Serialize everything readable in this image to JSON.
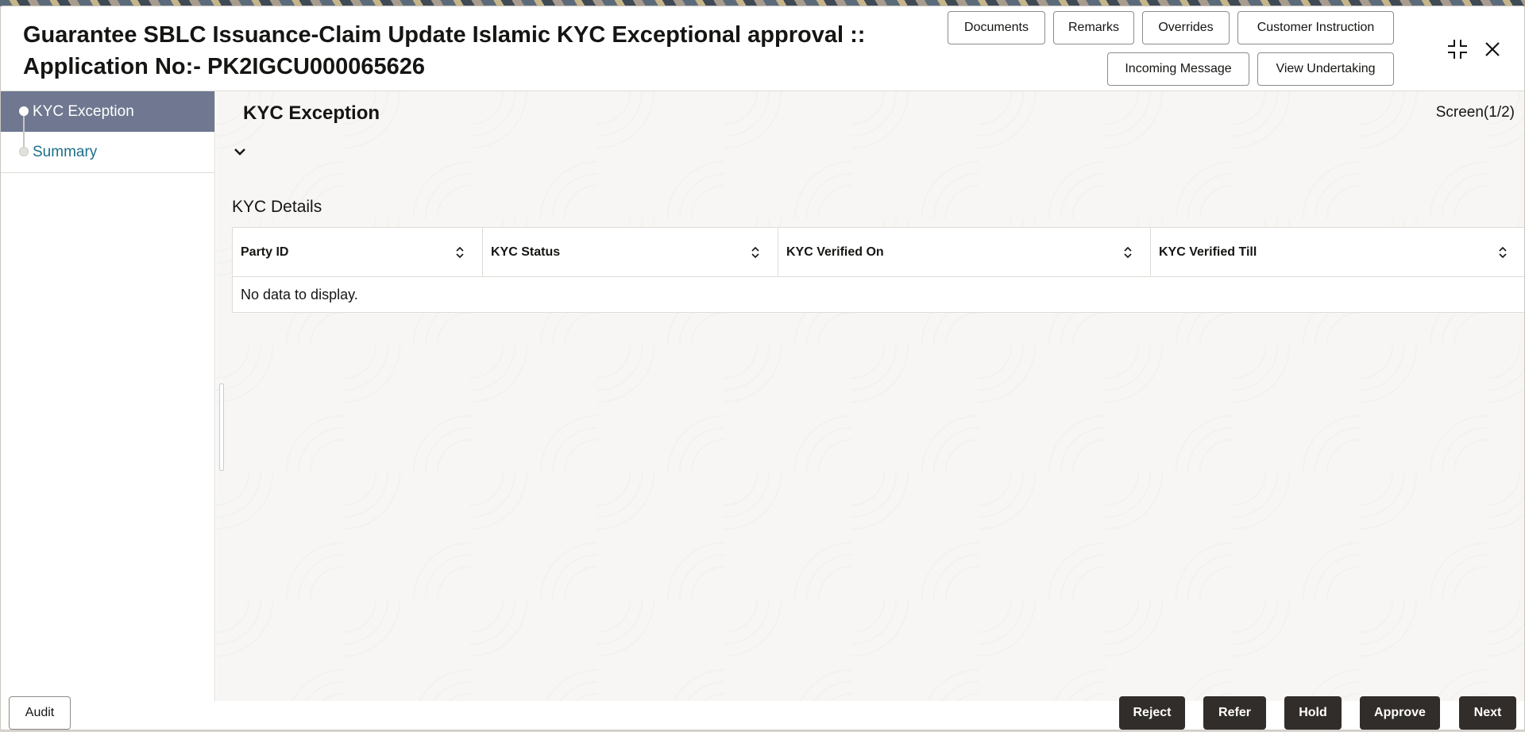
{
  "header": {
    "title_line1": "Guarantee SBLC Issuance-Claim Update Islamic KYC Exceptional approval ::",
    "title_line2": "Application No:- PK2IGCU000065626",
    "buttons": {
      "documents": "Documents",
      "remarks": "Remarks",
      "overrides": "Overrides",
      "customer_instruction": "Customer Instruction",
      "incoming_message": "Incoming Message",
      "view_undertaking": "View Undertaking"
    },
    "icons": {
      "minimize": "compress-icon",
      "close": "close-icon"
    }
  },
  "sidebar": {
    "items": [
      {
        "label": "KYC Exception",
        "active": true
      },
      {
        "label": "Summary",
        "active": false
      }
    ]
  },
  "main": {
    "section_title": "KYC Exception",
    "screen_counter": "Screen(1/2)",
    "sub_title": "KYC Details",
    "table": {
      "columns": [
        "Party ID",
        "KYC Status",
        "KYC Verified On",
        "KYC Verified Till"
      ],
      "empty_message": "No data to display."
    }
  },
  "footer": {
    "audit": "Audit",
    "reject": "Reject",
    "refer": "Refer",
    "hold": "Hold",
    "approve": "Approve",
    "next": "Next"
  },
  "colors": {
    "active_sidebar": "#6f7890",
    "link": "#1d6f8a",
    "dark_button": "#312d2a"
  }
}
